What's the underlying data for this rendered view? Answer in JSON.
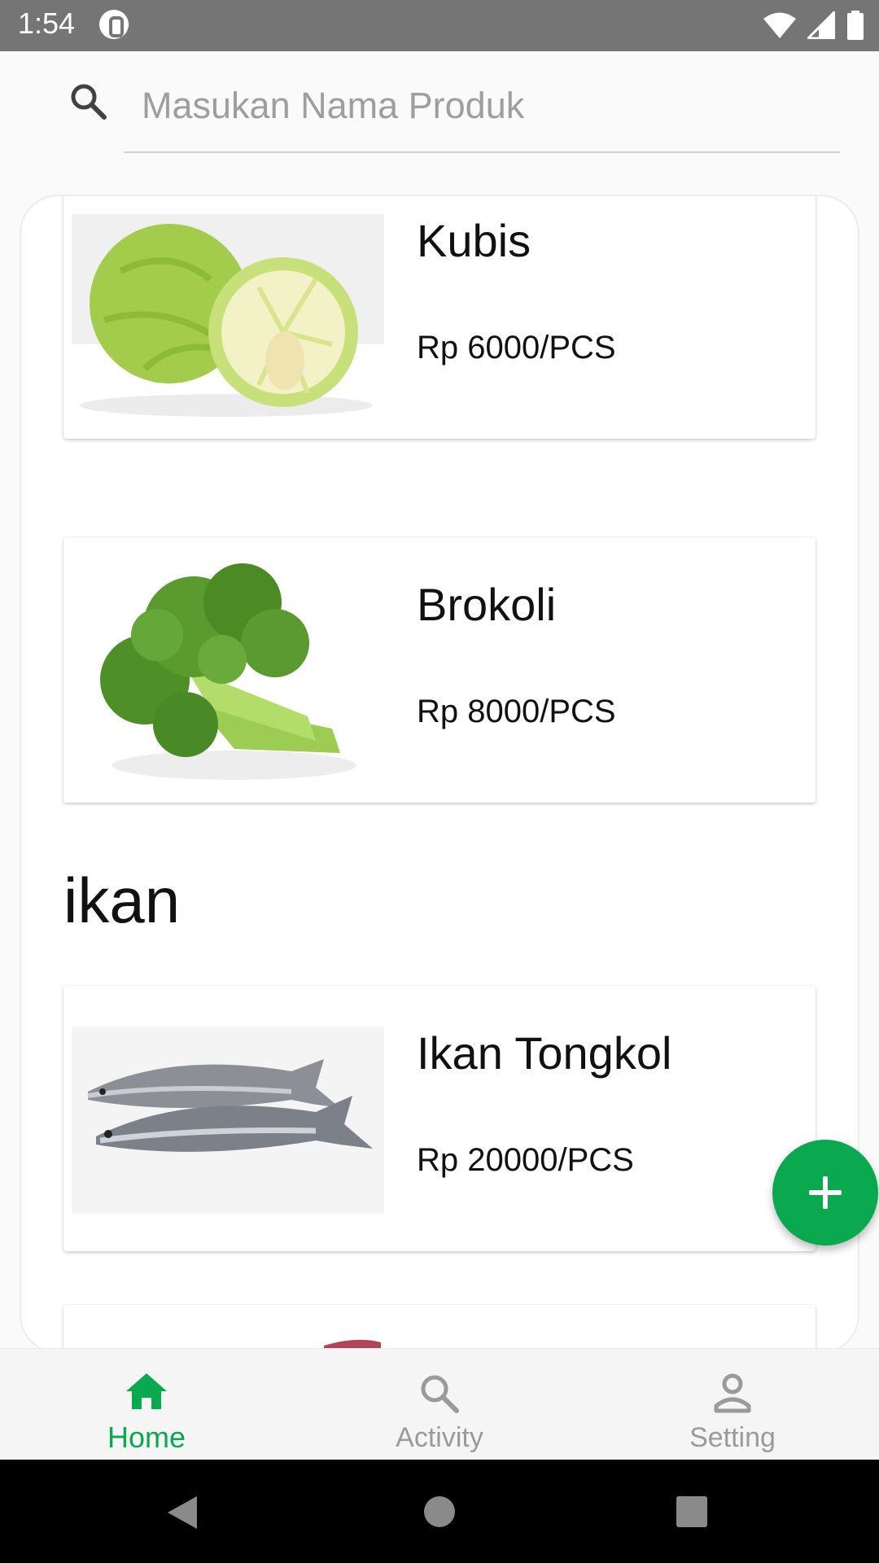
{
  "status_bar": {
    "time": "1:54"
  },
  "search": {
    "placeholder": "Masukan Nama Produk",
    "value": ""
  },
  "products_top": [
    {
      "name": "Kubis",
      "price": "Rp 6000/PCS",
      "image": "cabbage"
    },
    {
      "name": "Brokoli",
      "price": "Rp 8000/PCS",
      "image": "broccoli"
    }
  ],
  "category": {
    "title": "ikan"
  },
  "products_ikan": [
    {
      "name": "Ikan Tongkol",
      "price": "Rp 20000/PCS",
      "image": "tuna-fish"
    }
  ],
  "fab": {
    "icon": "plus-icon"
  },
  "bottom_nav": [
    {
      "label": "Home",
      "icon": "home-icon",
      "active": true
    },
    {
      "label": "Activity",
      "icon": "search-icon",
      "active": false
    },
    {
      "label": "Setting",
      "icon": "person-icon",
      "active": false
    }
  ],
  "colors": {
    "accent": "#0aa84f",
    "status_bar": "#757575",
    "inactive": "#9a9a9a"
  }
}
